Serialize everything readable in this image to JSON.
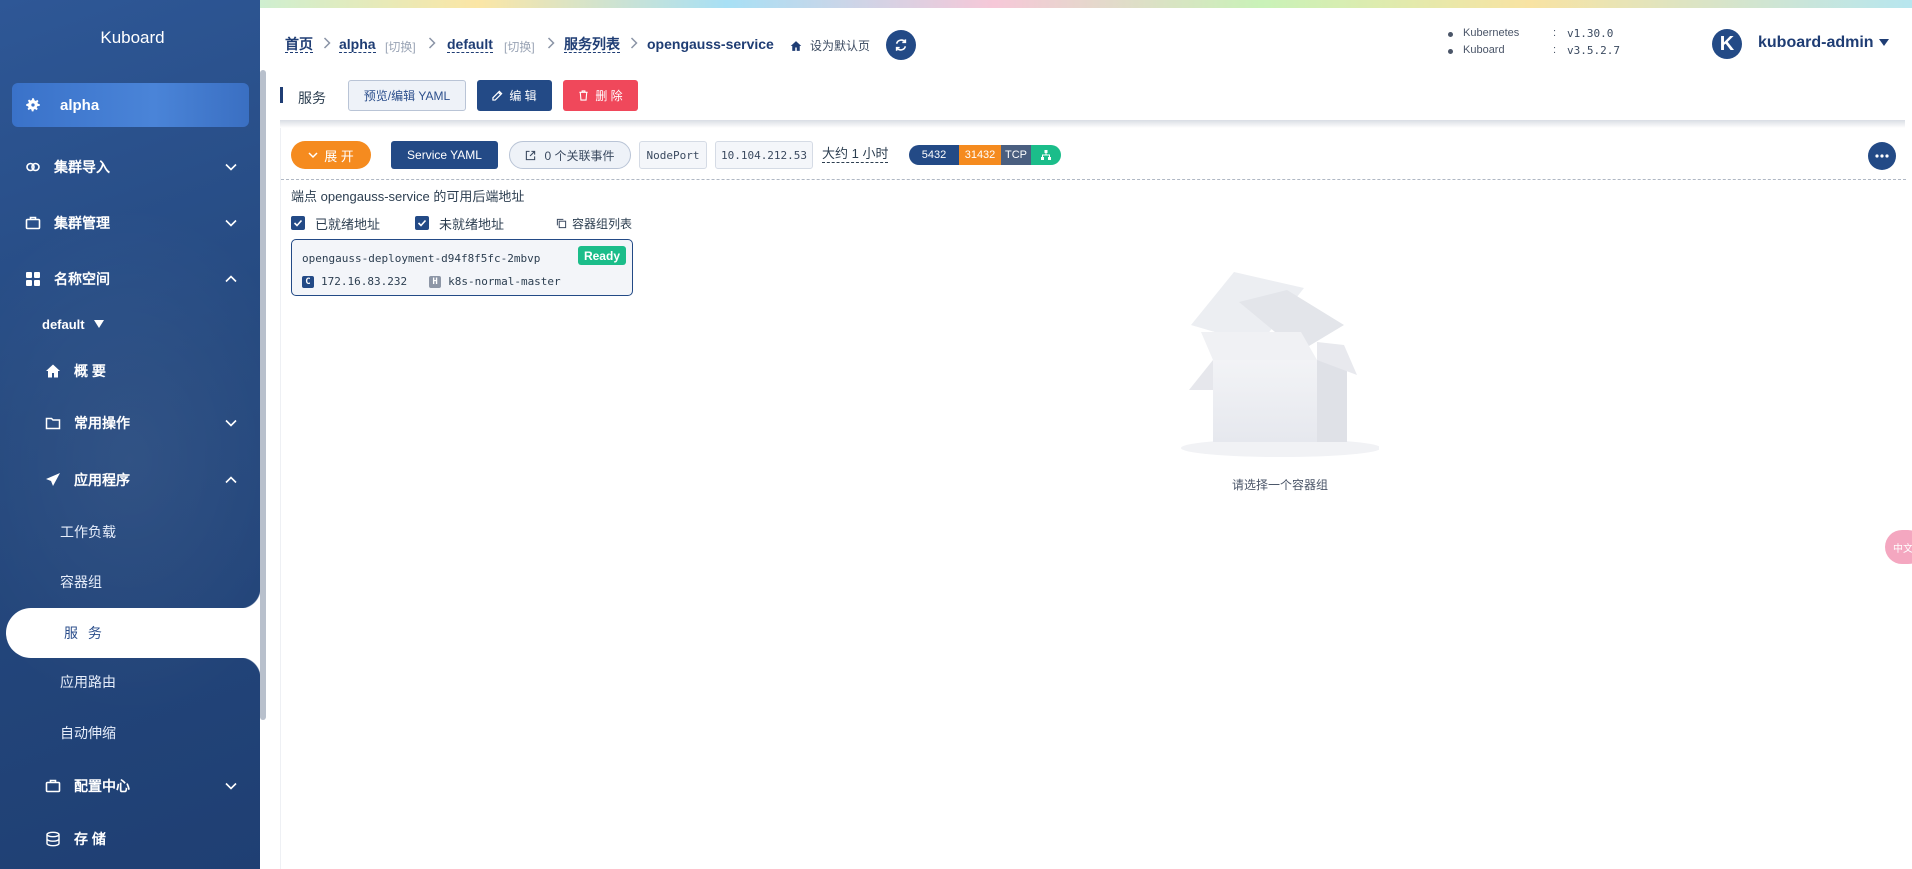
{
  "sidebar": {
    "brand": "Kuboard",
    "current_namespace": "alpha",
    "items": [
      {
        "label": "集群导入"
      },
      {
        "label": "集群管理"
      },
      {
        "label": "名称空间"
      }
    ],
    "namespace_select": "default",
    "ns_items": [
      {
        "label": "概 要"
      },
      {
        "label": "常用操作"
      },
      {
        "label": "应用程序"
      }
    ],
    "app_items": [
      {
        "label": "工作负载"
      },
      {
        "label": "容器组"
      },
      {
        "label": "服 务"
      },
      {
        "label": "应用路由"
      },
      {
        "label": "自动伸缩"
      }
    ],
    "bottom_items": [
      {
        "label": "配置中心"
      },
      {
        "label": "存 储"
      }
    ]
  },
  "header": {
    "breadcrumb": {
      "home": "首页",
      "cluster": "alpha",
      "cluster_switch": "[切换]",
      "namespace": "default",
      "namespace_switch": "[切换]",
      "service_list": "服务列表",
      "current": "opengauss-service",
      "set_default": "设为默认页"
    },
    "versions": [
      {
        "name": "Kubernetes",
        "value": "v1.30.0"
      },
      {
        "name": "Kuboard",
        "value": "v3.5.2.7"
      }
    ],
    "user": {
      "avatar_letter": "K",
      "name": "kuboard-admin"
    }
  },
  "toolbar": {
    "title": "服务",
    "preview_yaml": "预览/编辑 YAML",
    "edit": "编 辑",
    "delete": "删 除"
  },
  "service": {
    "expand": "展 开",
    "yaml": "Service YAML",
    "events": "0 个关联事件",
    "type": "NodePort",
    "cluster_ip": "10.104.212.53",
    "age": "大约 1 小时",
    "port": "5432",
    "node_port": "31432",
    "protocol": "TCP"
  },
  "endpoints": {
    "title": "端点 opengauss-service 的可用后端地址",
    "ready_label": "已就绪地址",
    "not_ready_label": "未就绪地址",
    "pods_link": "容器组列表",
    "pod": {
      "name": "opengauss-deployment-d94f8f5fc-2mbvp",
      "status": "Ready",
      "ip_badge": "C",
      "ip": "172.16.83.232",
      "host_badge": "H",
      "host": "k8s-normal-master"
    },
    "empty_text": "请选择一个容器组"
  },
  "float_tab": "中文"
}
